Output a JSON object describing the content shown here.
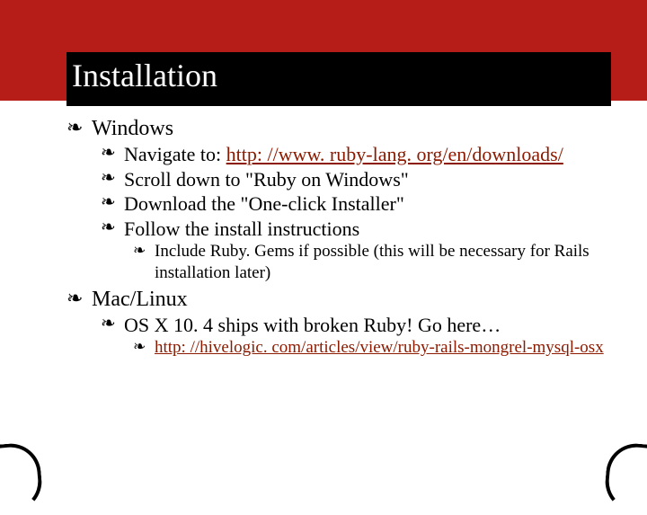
{
  "title": "Installation",
  "bullets": {
    "win": "Windows",
    "nav_pre": "Navigate to: ",
    "nav_url": "http: //www. ruby-lang. org/en/downloads/",
    "scroll": "Scroll down to \"Ruby on Windows\"",
    "download": "Download the \"One-click Installer\"",
    "follow": "Follow the install instructions",
    "include": "Include Ruby. Gems if possible (this will be necessary for Rails installation later)",
    "mac": "Mac/Linux",
    "osx": "OS X 10. 4 ships with broken Ruby! Go here…",
    "hive_url": "http: //hivelogic. com/articles/view/ruby-rails-mongrel-mysql-osx"
  }
}
